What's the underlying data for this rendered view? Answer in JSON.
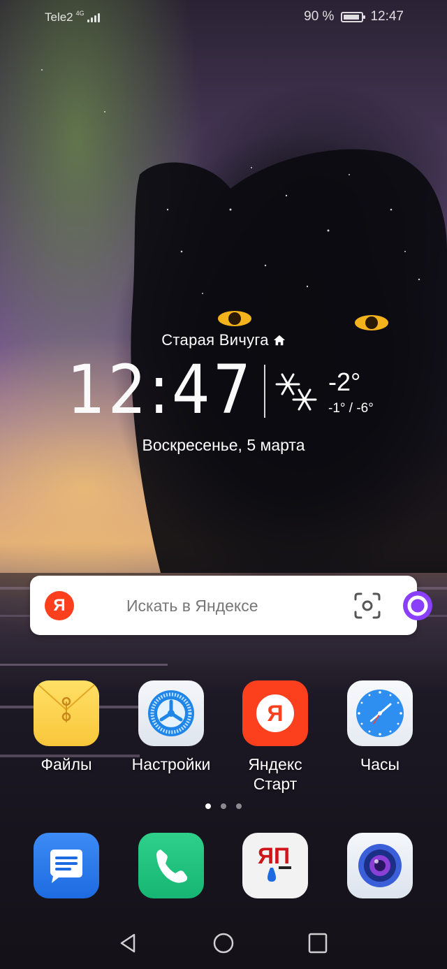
{
  "status_bar": {
    "carrier": "Tele2",
    "network": "4G",
    "signal_bars": 4,
    "battery": "90 %",
    "battery_level": 0.9,
    "time": "12:47"
  },
  "widget": {
    "city": "Старая Вичуга",
    "time": "12:47",
    "weather_icon": "snowflake-icon",
    "temperature": "-2°",
    "temp_range": "-1° / -6°",
    "date": "Воскресенье, 5 марта"
  },
  "search": {
    "logo": "Я",
    "placeholder": "Искать в Яндексе",
    "camera_icon": "camera-scan-icon",
    "assistant_icon": "alice-icon"
  },
  "apps": [
    {
      "label": "Файлы",
      "icon": "files-icon"
    },
    {
      "label": "Настройки",
      "icon": "settings-icon"
    },
    {
      "label": "Яндекс Старт",
      "icon": "yandex-start-icon"
    },
    {
      "label": "Часы",
      "icon": "clock-icon"
    }
  ],
  "page_indicator": {
    "pages": 3,
    "active": 0
  },
  "dock": [
    {
      "icon": "messages-icon"
    },
    {
      "icon": "phone-icon"
    },
    {
      "icon": "yap-icon",
      "text": "ЯП"
    },
    {
      "icon": "camera-app-icon"
    }
  ],
  "nav": {
    "back": "back-icon",
    "home": "home-icon",
    "recents": "recents-icon"
  },
  "colors": {
    "yandex_red": "#fc3f1d",
    "alice_purple": "#8a3ffc",
    "clock_blue": "#2f8ff0"
  }
}
